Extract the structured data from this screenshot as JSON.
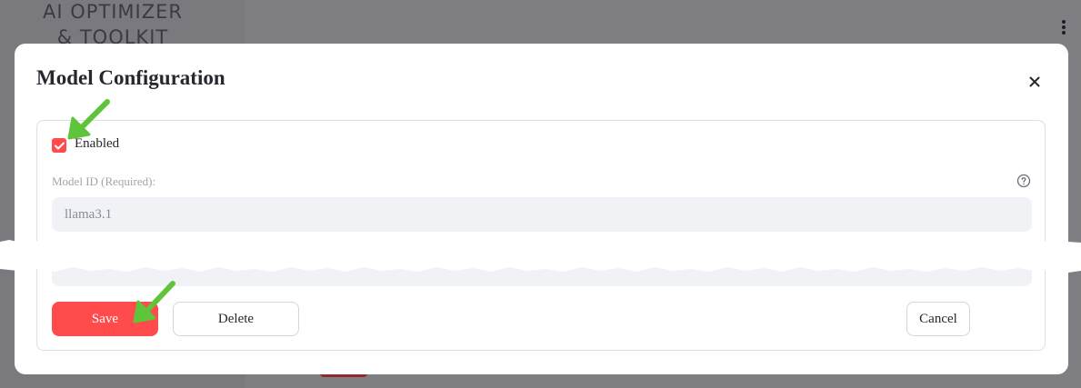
{
  "background": {
    "logo_line1": "AI OPTIMIZER",
    "logo_line2": "& TOOLKIT",
    "kebab_icon": "more-vertical-icon"
  },
  "dialog": {
    "title": "Model Configuration",
    "close_icon": "close-icon",
    "enabled": {
      "label": "Enabled",
      "checked": true
    },
    "model_id": {
      "label": "Model ID (Required):",
      "value": "llama3.1",
      "help_icon": "help-circle-icon"
    },
    "buttons": {
      "save": "Save",
      "delete": "Delete",
      "cancel": "Cancel"
    }
  },
  "colors": {
    "primary": "#ff4b4b",
    "annotation_arrow": "#5ec43a",
    "overlay": "#7f7f83"
  }
}
